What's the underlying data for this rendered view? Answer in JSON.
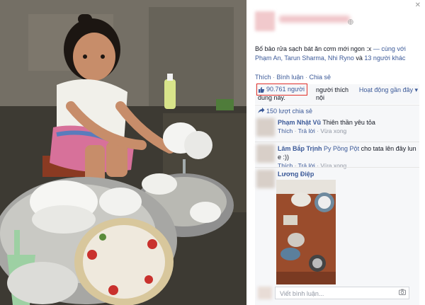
{
  "photo": {
    "alt_subject": "child-washing-dishes"
  },
  "post": {
    "caption": "Bố bảo rửa sạch bát ăn cơm mới ngon :x",
    "tagged_prefix": " — cùng với",
    "tagged_names": "Phạm An, Tarun Sharma, Nhi Ryno",
    "tagged_and": " và ",
    "tagged_others": "13 người khác"
  },
  "actions": {
    "like": "Thích",
    "comment": "Bình luận",
    "share": "Chia sẻ",
    "sep": " · "
  },
  "likes": {
    "count": "90.761 người",
    "text_line1": "người thích nội",
    "text_line2": "dung này.",
    "recent": "Hoạt động gần đây ▾"
  },
  "shares": {
    "text": "150 lượt chia sẻ"
  },
  "comments": [
    {
      "name": "Phạm Nhật Vũ",
      "text": "Thiên thần yêu tỏa",
      "like": "Thích",
      "reply": "Trả lời",
      "time": "Vừa xong"
    },
    {
      "name": "Lâm Bắp Trịnh",
      "tag": "Py Pồng Pột",
      "text": "cho tata lên đây lun e :))",
      "like": "Thích",
      "reply": "Trả lời",
      "time": "Vừa xong"
    },
    {
      "name": "Lương Điệp"
    }
  ],
  "input": {
    "placeholder": "Viết bình luận..."
  },
  "icons": {
    "close": "✕",
    "globe": "⚙",
    "like": "👍",
    "share": "↪",
    "camera": "📷"
  },
  "colors": {
    "link": "#3b5998",
    "highlight": "#e0312b",
    "panel_bg": "#f6f7f9"
  }
}
